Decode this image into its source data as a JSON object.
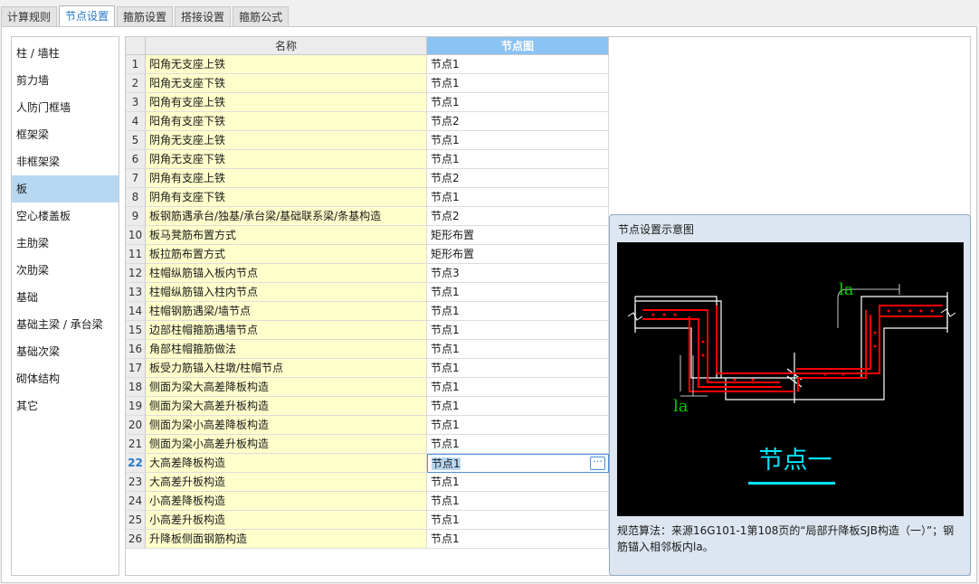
{
  "tabs": [
    {
      "label": "计算规则"
    },
    {
      "label": "节点设置"
    },
    {
      "label": "箍筋设置"
    },
    {
      "label": "搭接设置"
    },
    {
      "label": "箍筋公式"
    }
  ],
  "active_tab": 1,
  "sidebar": {
    "items": [
      {
        "label": "柱 / 墙柱"
      },
      {
        "label": "剪力墙"
      },
      {
        "label": "人防门框墙"
      },
      {
        "label": "框架梁"
      },
      {
        "label": "非框架梁"
      },
      {
        "label": "板"
      },
      {
        "label": "空心楼盖板"
      },
      {
        "label": "主肋梁"
      },
      {
        "label": "次肋梁"
      },
      {
        "label": "基础"
      },
      {
        "label": "基础主梁 / 承台梁"
      },
      {
        "label": "基础次梁"
      },
      {
        "label": "砌体结构"
      },
      {
        "label": "其它"
      }
    ],
    "selected": 5
  },
  "table": {
    "headers": {
      "name": "名称",
      "node": "节点图"
    },
    "active_row": 22,
    "rows": [
      {
        "idx": "1",
        "name": "阳角无支座上铁",
        "node": "节点1"
      },
      {
        "idx": "2",
        "name": "阳角无支座下铁",
        "node": "节点1"
      },
      {
        "idx": "3",
        "name": "阳角有支座上铁",
        "node": "节点1"
      },
      {
        "idx": "4",
        "name": "阳角有支座下铁",
        "node": "节点2"
      },
      {
        "idx": "5",
        "name": "阴角无支座上铁",
        "node": "节点1"
      },
      {
        "idx": "6",
        "name": "阴角无支座下铁",
        "node": "节点1"
      },
      {
        "idx": "7",
        "name": "阴角有支座上铁",
        "node": "节点2"
      },
      {
        "idx": "8",
        "name": "阴角有支座下铁",
        "node": "节点1"
      },
      {
        "idx": "9",
        "name": "板钢筋遇承台/独基/承台梁/基础联系梁/条基构造",
        "node": "节点2"
      },
      {
        "idx": "10",
        "name": "板马凳筋布置方式",
        "node": "矩形布置"
      },
      {
        "idx": "11",
        "name": "板拉筋布置方式",
        "node": "矩形布置"
      },
      {
        "idx": "12",
        "name": "柱帽纵筋锚入板内节点",
        "node": "节点3"
      },
      {
        "idx": "13",
        "name": "柱帽纵筋锚入柱内节点",
        "node": "节点1"
      },
      {
        "idx": "14",
        "name": "柱帽钢筋遇梁/墙节点",
        "node": "节点1"
      },
      {
        "idx": "15",
        "name": "边部柱帽箍筋遇墙节点",
        "node": "节点1"
      },
      {
        "idx": "16",
        "name": "角部柱帽箍筋做法",
        "node": "节点1"
      },
      {
        "idx": "17",
        "name": "板受力筋锚入柱墩/柱帽节点",
        "node": "节点1"
      },
      {
        "idx": "18",
        "name": "侧面为梁大高差降板构造",
        "node": "节点1"
      },
      {
        "idx": "19",
        "name": "侧面为梁大高差升板构造",
        "node": "节点1"
      },
      {
        "idx": "20",
        "name": "侧面为梁小高差降板构造",
        "node": "节点1"
      },
      {
        "idx": "21",
        "name": "侧面为梁小高差升板构造",
        "node": "节点1"
      },
      {
        "idx": "22",
        "name": "大高差降板构造",
        "node": "节点1"
      },
      {
        "idx": "23",
        "name": "大高差升板构造",
        "node": "节点1"
      },
      {
        "idx": "24",
        "name": "小高差降板构造",
        "node": "节点1"
      },
      {
        "idx": "25",
        "name": "小高差升板构造",
        "node": "节点1"
      },
      {
        "idx": "26",
        "name": "升降板侧面钢筋构造",
        "node": "节点1"
      }
    ]
  },
  "popup": {
    "title": "节点设置示意图",
    "diagram_label": "节点一",
    "dim_label_top": "la",
    "dim_label_bottom": "la",
    "description": "规范算法：来源16G101-1第108页的“局部升降板SJB构造（一）”；钢筋锚入相邻板内la。"
  },
  "colors": {
    "accent": "#2a78c8",
    "header_highlight": "#8bc3f2",
    "name_cell_bg": "#ffffcc",
    "selected_bg": "#b8d8f2",
    "rebar_red": "#ff0000",
    "dim_green": "#00cc00",
    "label_cyan": "#00e5ff"
  }
}
